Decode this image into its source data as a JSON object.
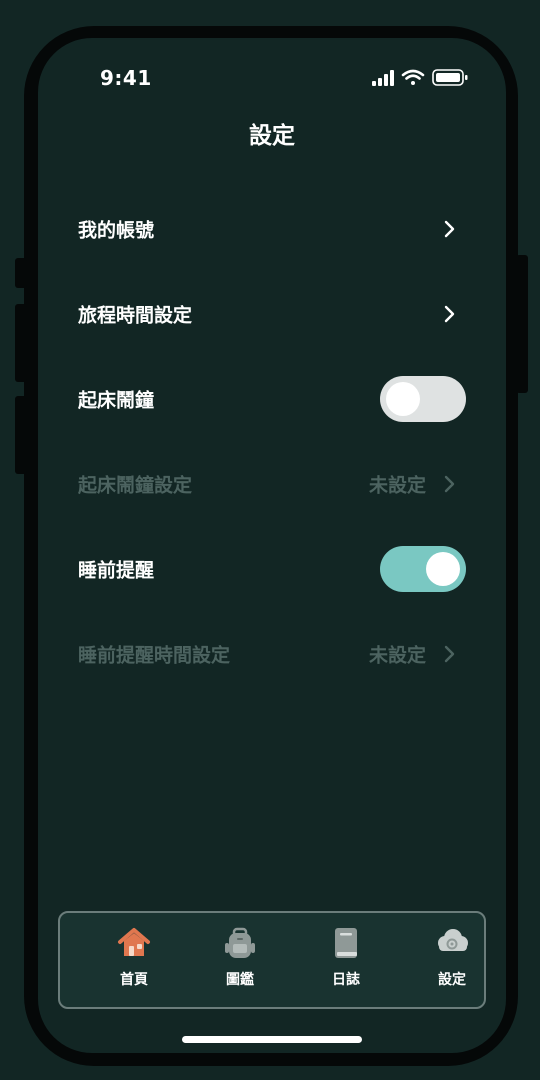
{
  "status_bar": {
    "time": "9:41"
  },
  "header": {
    "title": "設定"
  },
  "settings": {
    "items": [
      {
        "label": "我的帳號"
      },
      {
        "label": "旅程時間設定"
      },
      {
        "label": "起床鬧鐘",
        "toggle_on": false
      },
      {
        "label": "起床鬧鐘設定",
        "value": "未設定",
        "disabled": true
      },
      {
        "label": "睡前提醒",
        "toggle_on": true
      },
      {
        "label": "睡前提醒時間設定",
        "value": "未設定",
        "disabled": true
      }
    ]
  },
  "tabbar": {
    "tabs": [
      {
        "label": "首頁",
        "icon": "house-icon",
        "active": true
      },
      {
        "label": "圖鑑",
        "icon": "backpack-icon"
      },
      {
        "label": "日誌",
        "icon": "book-icon"
      },
      {
        "label": "設定",
        "icon": "cloud-gear-icon"
      }
    ]
  },
  "colors": {
    "background": "#122624",
    "toggle_on": "#7ac8c2",
    "toggle_off": "#dfe2e2",
    "disabled_text": "#4c6360",
    "home_icon": "#e0774f"
  }
}
